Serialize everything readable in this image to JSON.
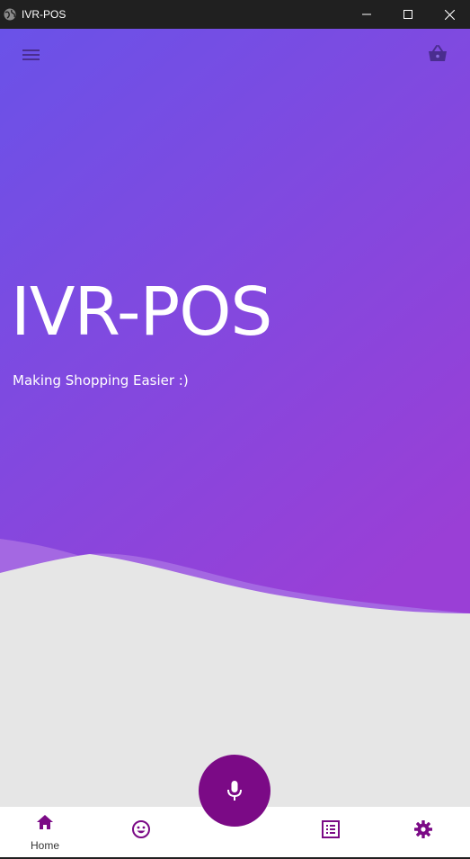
{
  "window": {
    "title": "IVR-POS",
    "controls": [
      "minimize",
      "maximize",
      "close"
    ]
  },
  "header": {
    "menu_icon": "hamburger-menu-icon",
    "cart_icon": "shopping-basket-icon"
  },
  "hero": {
    "title": "IVR-POS",
    "subtitle": "Making Shopping Easier :)",
    "gradient_top": "#6d4fe6",
    "gradient_bottom": "#9b40d8",
    "wave_color": "#a468e2"
  },
  "fab": {
    "icon": "microphone-icon",
    "color": "#7b0a86"
  },
  "bottom_nav": {
    "items": [
      {
        "icon": "home-icon",
        "label": "Home"
      },
      {
        "icon": "emoji-icon",
        "label": ""
      },
      {
        "icon": "list-icon",
        "label": ""
      },
      {
        "icon": "settings-icon",
        "label": ""
      }
    ],
    "icon_color": "#7b0a86"
  }
}
